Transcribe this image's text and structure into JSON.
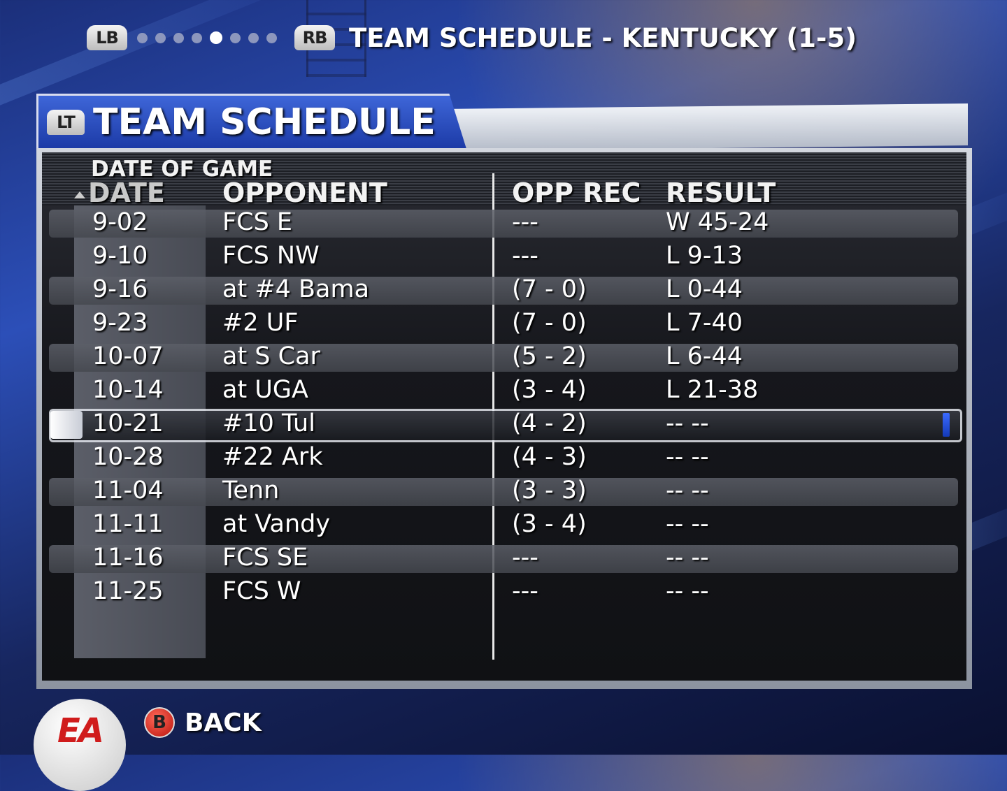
{
  "topbar": {
    "lb_label": "LB",
    "rb_label": "RB",
    "page_dots_total": 8,
    "page_dots_active": 4,
    "title": "TEAM SCHEDULE - KENTUCKY (1-5)"
  },
  "panel": {
    "lt_label": "LT",
    "title": "TEAM SCHEDULE",
    "sort_label": "DATE OF GAME"
  },
  "columns": {
    "date": "DATE",
    "opponent": "OPPONENT",
    "opp_rec": "OPP REC",
    "result": "RESULT"
  },
  "rows": [
    {
      "date": "9-02",
      "opponent": "FCS E",
      "opp_rec": "---",
      "result": "W 45-24"
    },
    {
      "date": "9-10",
      "opponent": "FCS NW",
      "opp_rec": "---",
      "result": "L 9-13"
    },
    {
      "date": "9-16",
      "opponent": "at #4 Bama",
      "opp_rec": "(7 - 0)",
      "result": "L 0-44"
    },
    {
      "date": "9-23",
      "opponent": "#2 UF",
      "opp_rec": "(7 - 0)",
      "result": "L 7-40"
    },
    {
      "date": "10-07",
      "opponent": "at S Car",
      "opp_rec": "(5 - 2)",
      "result": "L 6-44"
    },
    {
      "date": "10-14",
      "opponent": "at UGA",
      "opp_rec": "(3 - 4)",
      "result": "L 21-38"
    },
    {
      "date": "10-21",
      "opponent": "#10 Tul",
      "opp_rec": "(4 - 2)",
      "result": "-- --"
    },
    {
      "date": "10-28",
      "opponent": "#22 Ark",
      "opp_rec": "(4 - 3)",
      "result": "-- --"
    },
    {
      "date": "11-04",
      "opponent": "Tenn",
      "opp_rec": "(3 - 3)",
      "result": "-- --"
    },
    {
      "date": "11-11",
      "opponent": "at Vandy",
      "opp_rec": "(3 - 4)",
      "result": "-- --"
    },
    {
      "date": "11-16",
      "opponent": "FCS SE",
      "opp_rec": "---",
      "result": "-- --"
    },
    {
      "date": "11-25",
      "opponent": "FCS W",
      "opp_rec": "---",
      "result": "-- --"
    }
  ],
  "selected_row_index": 6,
  "footer": {
    "logo_text": "EA",
    "back_button_glyph": "B",
    "back_label": "BACK"
  },
  "colors": {
    "accent_blue": "#2a4fc4",
    "selection_marker": "#2a5cff",
    "back_button_red": "#d8231a"
  }
}
